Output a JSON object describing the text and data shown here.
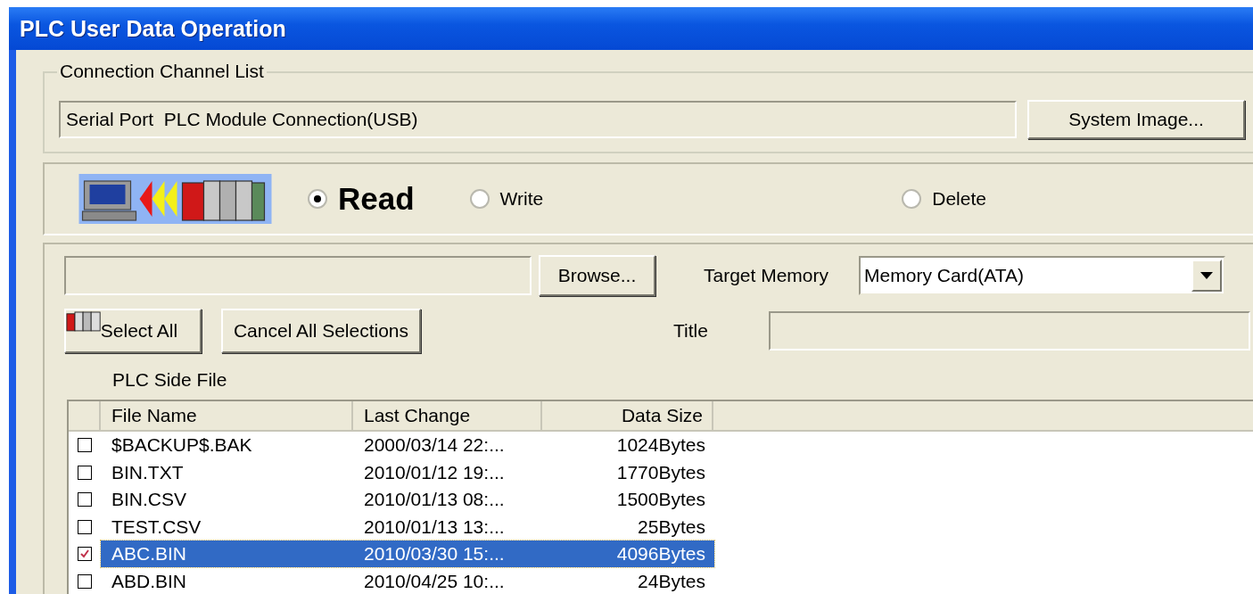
{
  "window": {
    "title": "PLC User Data Operation"
  },
  "connection": {
    "legend": "Connection Channel List",
    "channel": "Serial Port  PLC Module Connection(USB)",
    "button": "System Image..."
  },
  "operations": [
    {
      "label": "Read",
      "selected": true
    },
    {
      "label": "Write",
      "selected": false
    },
    {
      "label": "Delete",
      "selected": false
    }
  ],
  "browse_button": "Browse...",
  "target_memory": {
    "label": "Target Memory",
    "value": "Memory Card(ATA)"
  },
  "selection_buttons": [
    "Select All",
    "Cancel All Selections"
  ],
  "title_field": {
    "label": "Title"
  },
  "file_list": {
    "caption": "PLC Side File",
    "columns": [
      "File Name",
      "Last Change",
      "Data Size"
    ],
    "rows": [
      {
        "name": "$BACKUP$.BAK",
        "last_change": "2000/03/14 22:...",
        "size": "1024Bytes",
        "checked": false,
        "selected": false
      },
      {
        "name": "BIN.TXT",
        "last_change": "2010/01/12 19:...",
        "size": "1770Bytes",
        "checked": false,
        "selected": false
      },
      {
        "name": "BIN.CSV",
        "last_change": "2010/01/13 08:...",
        "size": "1500Bytes",
        "checked": false,
        "selected": false
      },
      {
        "name": "TEST.CSV",
        "last_change": "2010/01/13 13:...",
        "size": "25Bytes",
        "checked": false,
        "selected": false
      },
      {
        "name": "ABC.BIN",
        "last_change": "2010/03/30 15:...",
        "size": "4096Bytes",
        "checked": true,
        "selected": true
      },
      {
        "name": "ABD.BIN",
        "last_change": "2010/04/25 10:...",
        "size": "24Bytes",
        "checked": false,
        "selected": false
      }
    ]
  }
}
